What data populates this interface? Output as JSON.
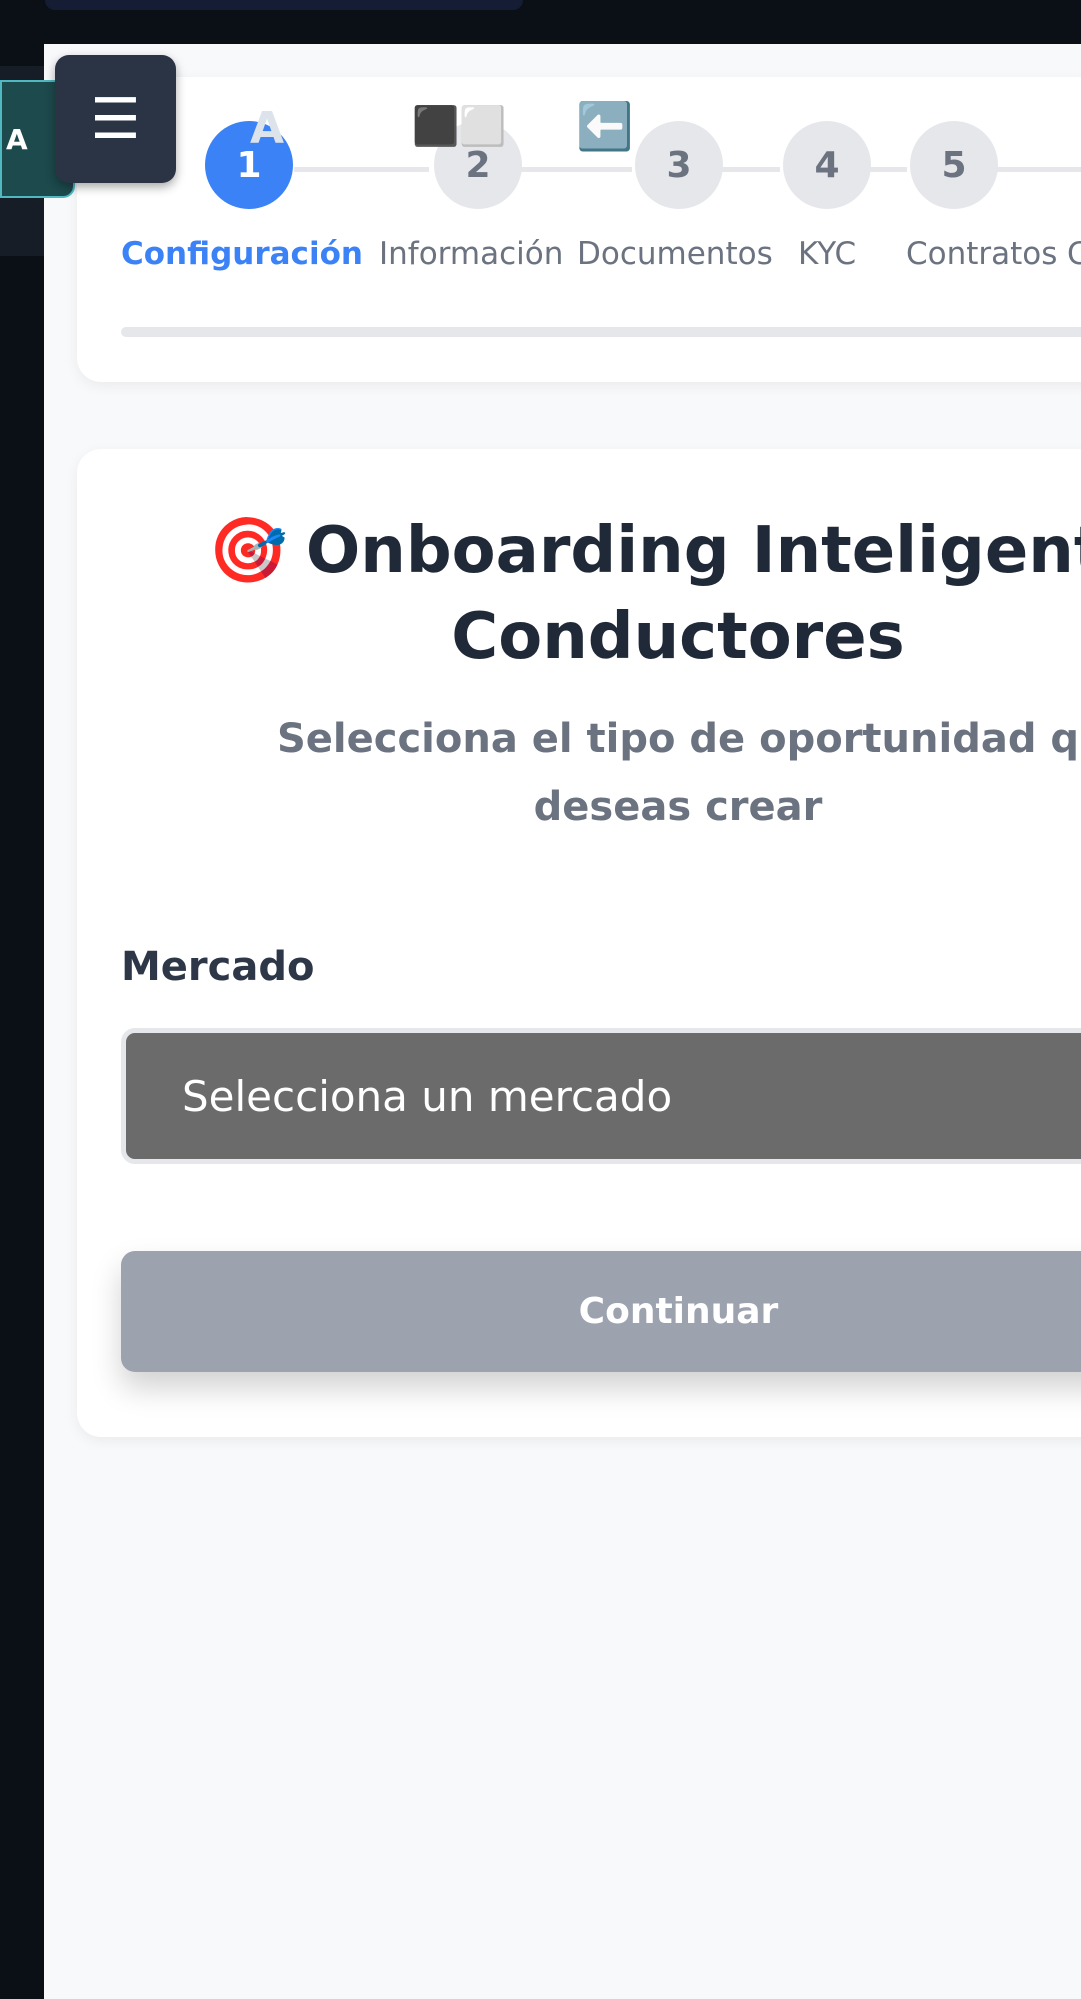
{
  "colors": {
    "accent": "#3b82f6",
    "inactive_step": "#e5e7eb",
    "title": "#1f2937",
    "muted": "#6b7280",
    "button_disabled": "#9ca3af",
    "select_bg": "#6b6b6b",
    "sidebar_dark": "#0b1017"
  },
  "sidebar": {
    "tab_label": "A",
    "menu_icon": "hamburger-icon",
    "menu_glyph": "☰"
  },
  "stepper": {
    "steps": [
      {
        "number": "1",
        "label": "Configuración",
        "active": true
      },
      {
        "number": "2",
        "label": "Información",
        "active": false
      },
      {
        "number": "",
        "label": "Documentos",
        "active": false
      },
      {
        "number": "3",
        "label": "KYC",
        "active": false
      },
      {
        "number": "4",
        "label": "Contratos",
        "active": false
      },
      {
        "number": "5",
        "label": "Co",
        "active": false
      }
    ],
    "overlay_glyphs": {
      "letter": "A",
      "squares_icon": "black-white-squares-icon",
      "squares_glyph": "⬛⬜",
      "arrow_icon": "left-arrow-icon",
      "arrow_glyph": "⬅️"
    }
  },
  "form": {
    "title_icon": "target-icon",
    "title_icon_glyph": "🎯",
    "title_line1": "Onboarding Inteligente",
    "title_line2": "Conductores",
    "subtitle_line1": "Selecciona el tipo de oportunidad q",
    "subtitle_line2": "deseas crear",
    "market_label": "Mercado",
    "market_select_placeholder": "Selecciona un mercado",
    "continue_label": "Continuar"
  }
}
